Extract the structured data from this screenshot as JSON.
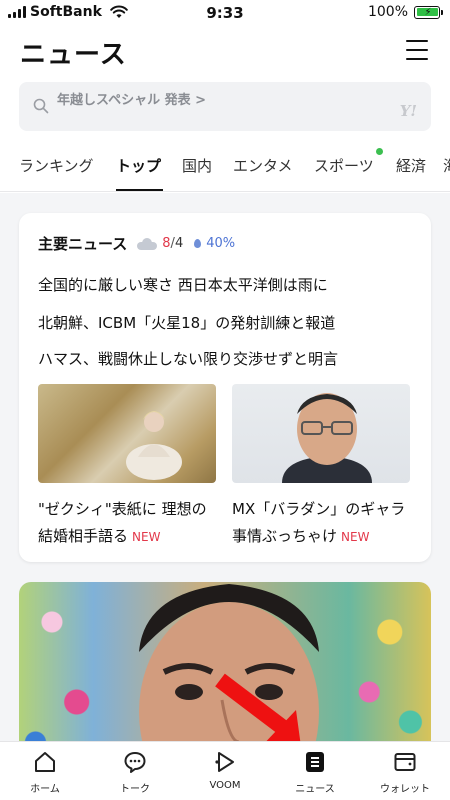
{
  "status_bar": {
    "carrier": "SoftBank",
    "time": "9:33",
    "battery": "100%"
  },
  "header": {
    "title": "ニュース"
  },
  "search": {
    "text": "年越しスペシャル 発表 >",
    "logo_text": "Y!"
  },
  "tabs": [
    {
      "label": "ランキング"
    },
    {
      "label": "トップ"
    },
    {
      "label": "国内"
    },
    {
      "label": "エンタメ"
    },
    {
      "label": "スポーツ"
    },
    {
      "label": "経済"
    },
    {
      "label": "海"
    }
  ],
  "active_tab": "トップ",
  "main_news": {
    "title": "主要ニュース",
    "weather": {
      "high": "8",
      "sep": "/",
      "low": "4",
      "rain": "40%"
    },
    "headlines": [
      "全国的に厳しい寒さ 西日本太平洋側は雨に",
      "北朝鮮、ICBM「火星18」の発射訓練と報道",
      "ハマス、戦闘休止しない限り交渉せずと明言"
    ],
    "stories": [
      {
        "text": "\"ゼクシィ\"表紙に 理想の結婚相手語る",
        "badge": "NEW"
      },
      {
        "text": "MX「バラダン」のギャラ事情ぶっちゃけ",
        "badge": "NEW"
      }
    ]
  },
  "bottom_nav": [
    {
      "label": "ホーム",
      "icon": "home-icon"
    },
    {
      "label": "トーク",
      "icon": "chat-icon"
    },
    {
      "label": "VOOM",
      "icon": "voom-icon"
    },
    {
      "label": "ニュース",
      "icon": "news-icon"
    },
    {
      "label": "ウォレット",
      "icon": "wallet-icon"
    }
  ],
  "colors": {
    "accent_red": "#e2384a",
    "rain_blue": "#4e74d4",
    "tab_dot": "#3cbf50",
    "arrow": "#ee1111"
  }
}
